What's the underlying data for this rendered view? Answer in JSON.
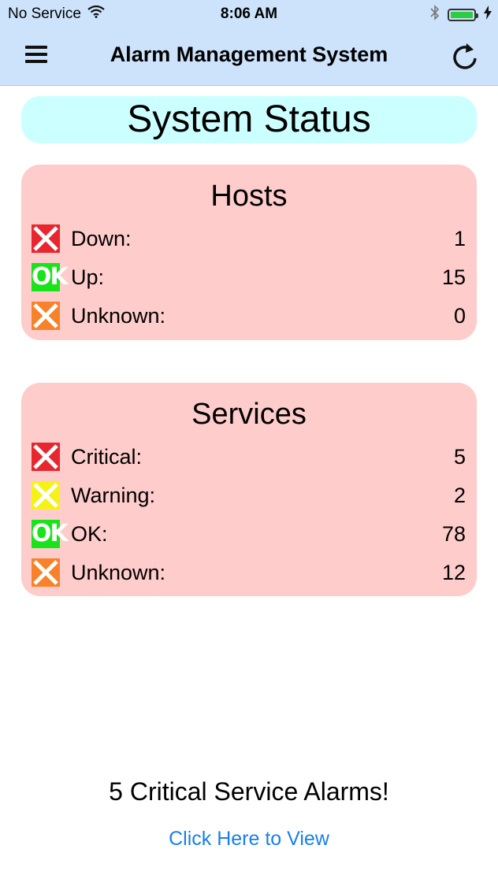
{
  "status_bar": {
    "carrier": "No Service",
    "time": "8:06 AM"
  },
  "nav": {
    "title": "Alarm Management System"
  },
  "banner": {
    "title": "System Status"
  },
  "hosts": {
    "title": "Hosts",
    "rows": [
      {
        "label": "Down:",
        "value": "1",
        "icon": "red-x-icon"
      },
      {
        "label": "Up:",
        "value": "15",
        "icon": "ok-icon"
      },
      {
        "label": "Unknown:",
        "value": "0",
        "icon": "orange-x-icon"
      }
    ]
  },
  "services": {
    "title": "Services",
    "rows": [
      {
        "label": "Critical:",
        "value": "5",
        "icon": "red-x-icon"
      },
      {
        "label": "Warning:",
        "value": "2",
        "icon": "yellow-x-icon"
      },
      {
        "label": "OK:",
        "value": "78",
        "icon": "ok-icon"
      },
      {
        "label": "Unknown:",
        "value": "12",
        "icon": "orange-x-icon"
      }
    ]
  },
  "alert": {
    "message": "5 Critical Service Alarms!",
    "link": "Click Here to View"
  },
  "icon_labels": {
    "ok": "OK"
  },
  "colors": {
    "nav_bg": "#cce3fb",
    "banner_bg": "#ccffff",
    "card_bg": "#fecccb",
    "critical": "#e8262e",
    "warning": "#f5f218",
    "unknown": "#f7822a",
    "ok": "#19e319",
    "link": "#1a7fe8"
  }
}
